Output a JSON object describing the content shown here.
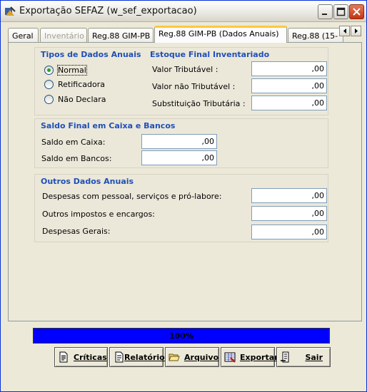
{
  "window": {
    "title": "Exportação SEFAZ (w_sef_exportacao)"
  },
  "tabs": [
    {
      "label": "Geral",
      "state": "normal"
    },
    {
      "label": "Inventário",
      "state": "disabled"
    },
    {
      "label": "Reg.88 GIM-PB",
      "state": "normal"
    },
    {
      "label": "Reg.88 GIM-PB (Dados Anuais)",
      "state": "active"
    },
    {
      "label": "Reg.88 (15-",
      "state": "normal"
    }
  ],
  "tipos": {
    "title": "Tipos de Dados Anuais",
    "options": [
      {
        "label": "Normal",
        "checked": true
      },
      {
        "label": "Retificadora",
        "checked": false
      },
      {
        "label": "Não Declara",
        "checked": false
      }
    ]
  },
  "estoque": {
    "title": "Estoque Final Inventariado",
    "fields": [
      {
        "label": "Valor Tributável :",
        "value": ",00"
      },
      {
        "label": "Valor não Tributável :",
        "value": ",00"
      },
      {
        "label": "Substituição Tributária :",
        "value": ",00"
      }
    ]
  },
  "saldo": {
    "title": "Saldo Final em Caixa e Bancos",
    "fields": [
      {
        "label": "Saldo em Caixa:",
        "value": ",00"
      },
      {
        "label": "Saldo em Bancos:",
        "value": ",00"
      }
    ]
  },
  "outros": {
    "title": "Outros Dados Anuais",
    "fields": [
      {
        "label": "Despesas com pessoal, serviços  e pró-labore:",
        "value": ",00"
      },
      {
        "label": "Outros impostos e encargos:",
        "value": ",00"
      },
      {
        "label": "Despesas Gerais:",
        "value": ",00"
      }
    ]
  },
  "progress": {
    "text": "100%",
    "value": 100,
    "color": "#0000ff"
  },
  "buttons": [
    {
      "label": "Críticas",
      "icon": "document-icon"
    },
    {
      "label": "Relatórios",
      "icon": "report-icon"
    },
    {
      "label": "Arquivo",
      "icon": "folder-open-icon"
    },
    {
      "label": "Exportar",
      "icon": "export-icon"
    },
    {
      "label": "Sair",
      "icon": "exit-icon"
    }
  ]
}
